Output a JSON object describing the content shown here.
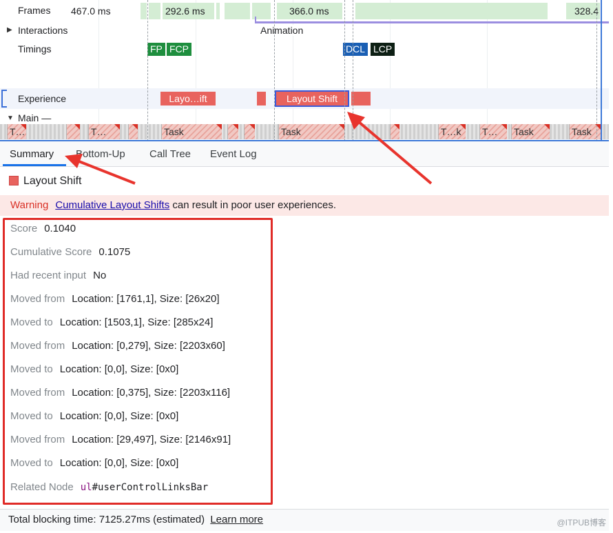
{
  "timeline": {
    "frames_label": "Frames",
    "frames": [
      "467.0 ms",
      "292.6 ms",
      "366.0 ms",
      "328.4"
    ],
    "interactions_label": "Interactions",
    "animation_label": "Animation",
    "timings_label": "Timings",
    "markers": [
      "FP",
      "FCP",
      "DCL",
      "LCP"
    ],
    "experience_label": "Experience",
    "layout_shifts": [
      "Layo…ift",
      "",
      "Layout Shift",
      ""
    ],
    "main_label": "Main —",
    "tasks": [
      "T…",
      "T…",
      "Task",
      "Task",
      "T…k",
      "T…",
      "Task",
      "Task"
    ]
  },
  "tabs": [
    "Summary",
    "Bottom-Up",
    "Call Tree",
    "Event Log"
  ],
  "summary": {
    "title": "Layout Shift",
    "warning_label": "Warning",
    "warning_link": "Cumulative Layout Shifts",
    "warning_text": "can result in poor user experiences.",
    "details": [
      {
        "key": "Score",
        "value": "0.1040"
      },
      {
        "key": "Cumulative Score",
        "value": "0.1075"
      },
      {
        "key": "Had recent input",
        "value": "No"
      },
      {
        "key": "Moved from",
        "value": "Location: [1761,1], Size: [26x20]"
      },
      {
        "key": "Moved to",
        "value": "Location: [1503,1], Size: [285x24]"
      },
      {
        "key": "Moved from",
        "value": "Location: [0,279], Size: [2203x60]"
      },
      {
        "key": "Moved to",
        "value": "Location: [0,0], Size: [0x0]"
      },
      {
        "key": "Moved from",
        "value": "Location: [0,375], Size: [2203x116]"
      },
      {
        "key": "Moved to",
        "value": "Location: [0,0], Size: [0x0]"
      },
      {
        "key": "Moved from",
        "value": "Location: [29,497], Size: [2146x91]"
      },
      {
        "key": "Moved to",
        "value": "Location: [0,0], Size: [0x0]"
      }
    ],
    "related_node_label": "Related Node",
    "related_node_tag": "ul",
    "related_node_id": "#userControlLinksBar"
  },
  "footer": {
    "text": "Total blocking time: 7125.27ms (estimated)",
    "link": "Learn more"
  },
  "watermark": "@ITPUB博客",
  "colors": {
    "layout_shift": "#e8635e",
    "highlight_box": "#e02b27",
    "fp": "#1e8e3e",
    "dcl": "#1a5fb4",
    "lcp": "#0d1f14"
  }
}
